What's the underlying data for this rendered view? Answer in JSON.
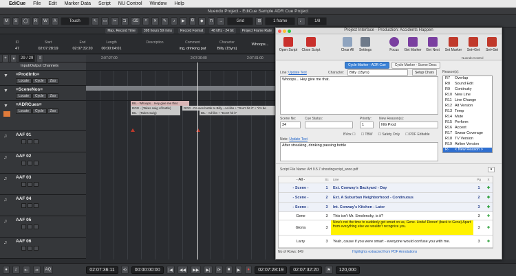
{
  "menubar": {
    "app": "EdiCue",
    "items": [
      "File",
      "Edit",
      "Marker Data",
      "Script",
      "NU Control",
      "Window",
      "Help"
    ]
  },
  "window": {
    "title": "Nuendo Project - EdiCue Sample ADR Cue Project"
  },
  "toolbar": {
    "mode": "Touch",
    "grid": "Grid",
    "grid_size": "1 frame",
    "quantize": "1/8"
  },
  "infobar": {
    "max_record": "Max. Record Time",
    "record_time": "398 hours 59 mins",
    "record_format": "Record Format",
    "format_value": "48 kHz - 24 bit",
    "frame_rate": "Project Frame Rate"
  },
  "eventbar": {
    "columns": [
      {
        "label": "ID",
        "value": "47"
      },
      {
        "label": "Start",
        "value": "02:07:28:19"
      },
      {
        "label": "End",
        "value": "02:07:32:20"
      },
      {
        "label": "Length",
        "value": "00:00:04:01"
      },
      {
        "label": "Description",
        "value": ""
      },
      {
        "label": "Comment",
        "value": "ing, drinking pat"
      },
      {
        "label": "Character",
        "value": "Billy (15yrs)"
      },
      {
        "label": "",
        "value": "Whoops..."
      }
    ]
  },
  "tracks_header": {
    "count": "29 / 29"
  },
  "ruler": {
    "marks": [
      "2:07:27:00",
      "2:07:30:00",
      "2:07:31:00"
    ]
  },
  "tracks": [
    {
      "name": "Input/Output Channels",
      "type": "folder"
    },
    {
      "name": "=ProdInfo=",
      "buttons": [
        "Locate",
        "Cycle",
        "Zoo"
      ]
    },
    {
      "name": "=SceneNos=",
      "buttons": [
        "Locate",
        "Cycle",
        "Zoo"
      ]
    },
    {
      "name": "=ADRCues=",
      "buttons": [
        "Locate",
        "Cycle",
        "Zoo"
      ]
    },
    {
      "name": "AAF 01"
    },
    {
      "name": "AAF 02"
    },
    {
      "name": "AAF 03"
    },
    {
      "name": "AAF 04"
    },
    {
      "name": "AAF 05"
    },
    {
      "name": "AAF 06"
    }
  ],
  "clips": {
    "adr1": "BIL - Whoops... Hey give me that.",
    "adr2": "DOG - (Takes swig of bottle)",
    "adr3": "DOG - Passes bottle to Billy - Ad-libs + \"Don't hit it\" + \"it's be",
    "adr4": "BIL - (Takes swig)",
    "adr5": "BIL - Ad-libs + \"Don't hit it\""
  },
  "transport": {
    "position": "02:07:36:11",
    "length": "00:00:00:00",
    "start": "02:07:28:19",
    "end": "02:07:32:20",
    "tempo": "120,000",
    "aq": "AQ"
  },
  "panel": {
    "title": "Project Interface - Production: Accidents Happen",
    "tools": [
      "Open Script",
      "Close Script",
      "Clear All",
      "Settings",
      "Focus",
      "Get Marker",
      "Get Next",
      "Set Marker",
      "Set+Get",
      "Set+Set"
    ],
    "nuendo_control": "Nuendo Control",
    "tabs": [
      "Cycle Marker - ADR Cue",
      "Cycle Marker - Scene Desc"
    ],
    "line_label": "Line:",
    "update_text": "Update Text",
    "character_label": "Character:",
    "character_value": "Billy (15yrs)",
    "setup_chars": "Setup Chars",
    "reasons_label": "Reason(s):",
    "line_text": "Whoops... Hey give me that.",
    "scene_label": "Scene No:",
    "scene_value": "34",
    "cue_status_label": "Cue Status:",
    "priority_label": "Priority:",
    "priority_value": "1",
    "new_reasons_label": "New Reason(s):",
    "new_reasons_value": "NG Prod",
    "note_label": "Note:",
    "note_text": "After streaking, drinking passing bottle",
    "options": [
      "BVox",
      "TBW",
      "Safety Only",
      "PDF Editable"
    ],
    "reasons": [
      [
        "R7",
        "Overlap"
      ],
      [
        "R8",
        "Sound Edit"
      ],
      [
        "R9",
        "Continuity"
      ],
      [
        "R10",
        "New Line"
      ],
      [
        "R11",
        "Line Change"
      ],
      [
        "R12",
        "Alt Version"
      ],
      [
        "R13",
        "Temp"
      ],
      [
        "R14",
        "Mute"
      ],
      [
        "R15",
        "Perform"
      ],
      [
        "R16",
        "Accent"
      ],
      [
        "R17",
        "Swear Coverage"
      ],
      [
        "R18",
        "TV Version"
      ],
      [
        "R19",
        "Airline Version"
      ],
      [
        "R-",
        "< New Reason >"
      ]
    ],
    "script_file_label": "Script File Name:",
    "script_file": "AH 9.5.7.shootingscript_anno.pdf",
    "table_headers": [
      "Char",
      "Sc",
      "Line",
      "Pg",
      "X"
    ],
    "rows": [
      {
        "char": "- All -",
        "sc": "",
        "line": "",
        "pg": "",
        "x": "",
        "kind": "filter"
      },
      {
        "char": "- Scene -",
        "sc": "1",
        "line": "Ext. Conway's Backyard - Day",
        "pg": "1",
        "x": "✚",
        "kind": "scene"
      },
      {
        "char": "- Scene -",
        "sc": "2",
        "line": "Ext. A Suburban Neighborhood - Continuous",
        "pg": "2",
        "x": "✚",
        "kind": "scene"
      },
      {
        "char": "- Scene -",
        "sc": "3",
        "line": "Int. Conway's Kitchen - Later",
        "pg": "3",
        "x": "✚",
        "kind": "scene"
      },
      {
        "char": "Gene",
        "sc": "3",
        "line": "This isn't Mr. Smolensky, is it?",
        "pg": "3",
        "x": "✚",
        "kind": "line"
      },
      {
        "char": "Gloria",
        "sc": "3",
        "line": "Now's not the time to suddenly get smart on us, Gene. Linda! Dinner! (back to Gene) Apart from everything else we wouldn't recognize you.",
        "pg": "3",
        "x": "✚",
        "kind": "hl"
      },
      {
        "char": "Larry",
        "sc": "3",
        "line": "Yeah, cause if you were smart - everyone would confuse you with me.",
        "pg": "3",
        "x": "✚",
        "kind": "line"
      }
    ],
    "rows_count": "No of Rows: 849",
    "highlights_note": "Highlights extracted from PDF Annotations"
  }
}
